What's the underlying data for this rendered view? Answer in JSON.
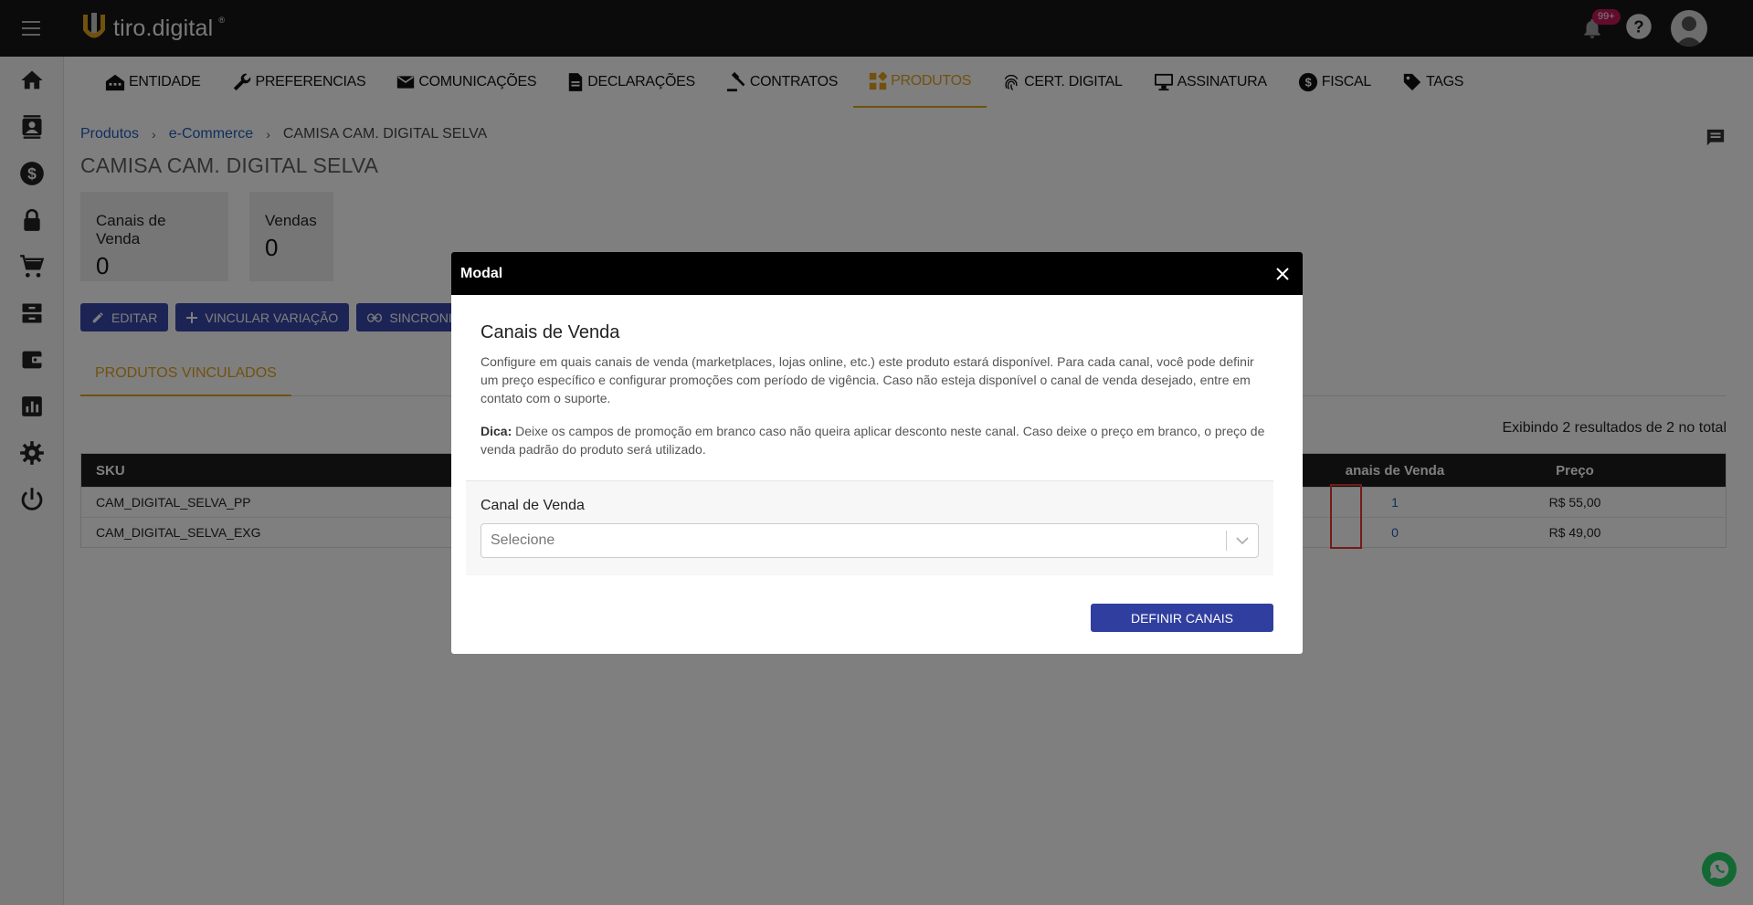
{
  "app": {
    "logo_text": "tiro.digital",
    "logo_mark": "®",
    "notifications_badge": "99+"
  },
  "nav": {
    "items": [
      {
        "label": "ENTIDADE",
        "icon": "building-icon"
      },
      {
        "label": "PREFERENCIAS",
        "icon": "wrench-icon"
      },
      {
        "label": "COMUNICAÇÕES",
        "icon": "mail-icon"
      },
      {
        "label": "DECLARAÇÕES",
        "icon": "document-icon"
      },
      {
        "label": "CONTRATOS",
        "icon": "gavel-icon"
      },
      {
        "label": "PRODUTOS",
        "icon": "grid-icon",
        "active": true
      },
      {
        "label": "CERT. DIGITAL",
        "icon": "fingerprint-icon"
      },
      {
        "label": "ASSINATURA",
        "icon": "monitor-icon"
      },
      {
        "label": "FISCAL",
        "icon": "dollar-circle-icon"
      },
      {
        "label": "TAGS",
        "icon": "tag-icon"
      }
    ]
  },
  "breadcrumb": {
    "items": [
      "Produtos",
      "e-Commerce",
      "CAMISA CAM. DIGITAL SELVA"
    ]
  },
  "page": {
    "title": "CAMISA CAM. DIGITAL SELVA",
    "stats": [
      {
        "label": "Canais de Venda",
        "value": "0"
      },
      {
        "label": "Vendas",
        "value": "0"
      }
    ],
    "actions": [
      "EDITAR",
      "VINCULAR VARIAÇÃO",
      "SINCRONIZ"
    ],
    "tab": "PRODUTOS VINCULADOS",
    "results_text": "Exibindo 2 resultados de 2 no total"
  },
  "table": {
    "headers": {
      "sku": "SKU",
      "canais": "anais de Venda",
      "preco": "Preço"
    },
    "rows": [
      {
        "sku": "CAM_DIGITAL_SELVA_PP",
        "canais": "1",
        "preco": "R$ 55,00"
      },
      {
        "sku": "CAM_DIGITAL_SELVA_EXG",
        "canais": "0",
        "preco": "R$ 49,00"
      }
    ]
  },
  "modal": {
    "title": "Modal",
    "heading": "Canais de Venda",
    "description": "Configure em quais canais de venda (marketplaces, lojas online, etc.) este produto estará disponível. Para cada canal, você pode definir um preço específico e configurar promoções com período de vigência. Caso não esteja disponível o canal de venda desejado, entre em contato com o suporte.",
    "tip_label": "Dica:",
    "tip_text": " Deixe os campos de promoção em branco caso não queira aplicar desconto neste canal. Caso deixe o preço em branco, o preço de venda padrão do produto será utilizado.",
    "field_label": "Canal de Venda",
    "select_placeholder": "Selecione",
    "submit_label": "DEFINIR CANAIS"
  },
  "colors": {
    "accent": "#e2a21d",
    "primary": "#3949ab",
    "header_bg": "#161616",
    "link": "#1f5dba"
  }
}
